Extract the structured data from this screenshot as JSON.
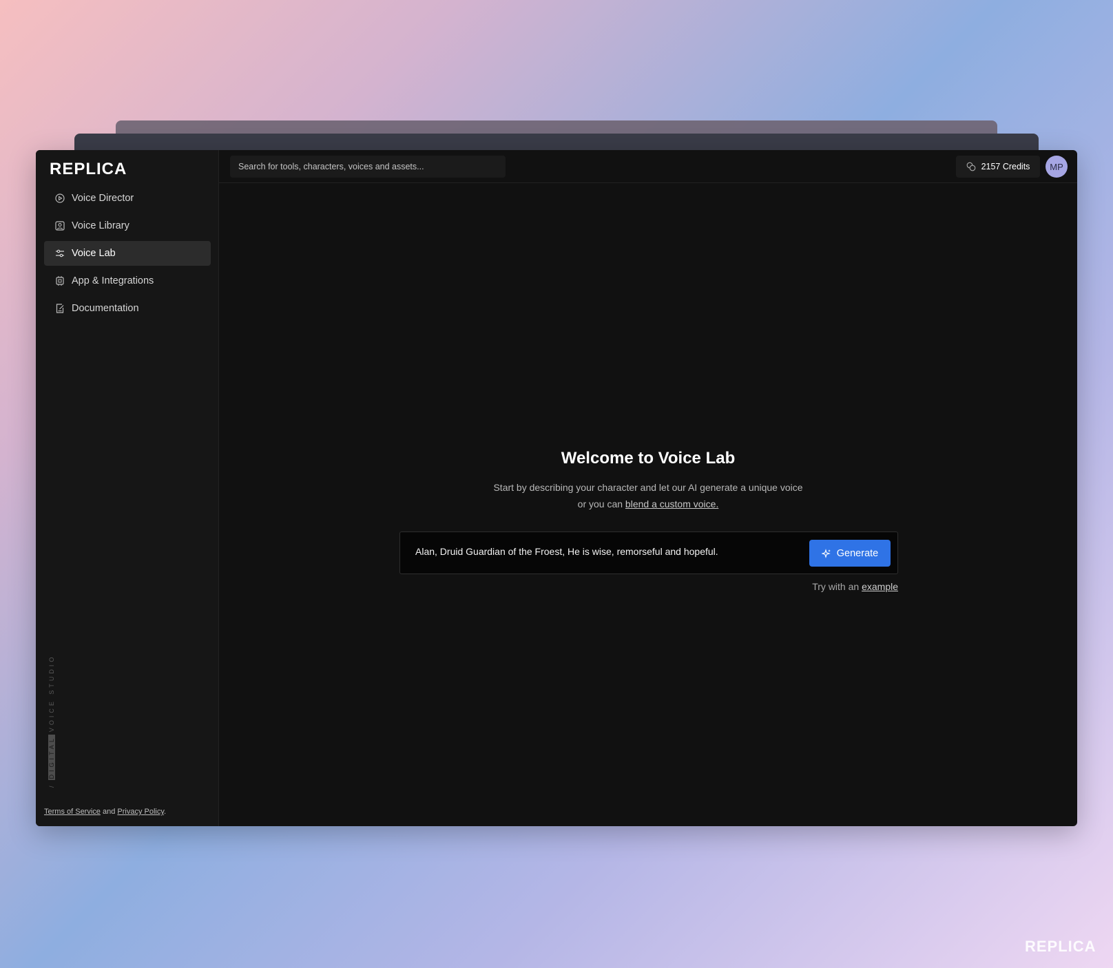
{
  "app": {
    "logo_text": "REPLICA",
    "watermark_text": "REPLICA"
  },
  "colors": {
    "accent": "#2f73e6",
    "window_bg": "#111111",
    "sidebar_bg": "#161616",
    "avatar_bg": "#a6a6e4"
  },
  "sidebar": {
    "items": [
      {
        "label": "Voice Director",
        "icon": "play-circle-icon",
        "active": false
      },
      {
        "label": "Voice Library",
        "icon": "user-square-icon",
        "active": false
      },
      {
        "label": "Voice Lab",
        "icon": "sliders-icon",
        "active": true
      },
      {
        "label": "App & Integrations",
        "icon": "chip-icon",
        "active": false
      },
      {
        "label": "Documentation",
        "icon": "document-edit-icon",
        "active": false
      }
    ],
    "vertical_tag": {
      "prefix": "/",
      "highlight": "DIGITAL",
      "rest": "VOICE STUDIO"
    },
    "legal": {
      "terms": "Terms of Service",
      "and": " and ",
      "privacy": "Privacy Policy",
      "end": "."
    }
  },
  "header": {
    "search_placeholder": "Search for tools, characters, voices and assets...",
    "credits": "2157 Credits",
    "avatar_initials": "MP"
  },
  "main": {
    "title_prefix": "Welcome to ",
    "title_bold": "Voice Lab",
    "subtitle_line1": "Start by describing your character and let our AI generate a unique voice",
    "subtitle_line2_prefix": "or you can ",
    "subtitle_link": "blend a custom voice.",
    "prompt_value": "Alan, Druid Guardian of the Froest, He is wise, remorseful and hopeful.",
    "generate_label": "Generate",
    "try_prefix": "Try with an ",
    "try_link": "example"
  }
}
